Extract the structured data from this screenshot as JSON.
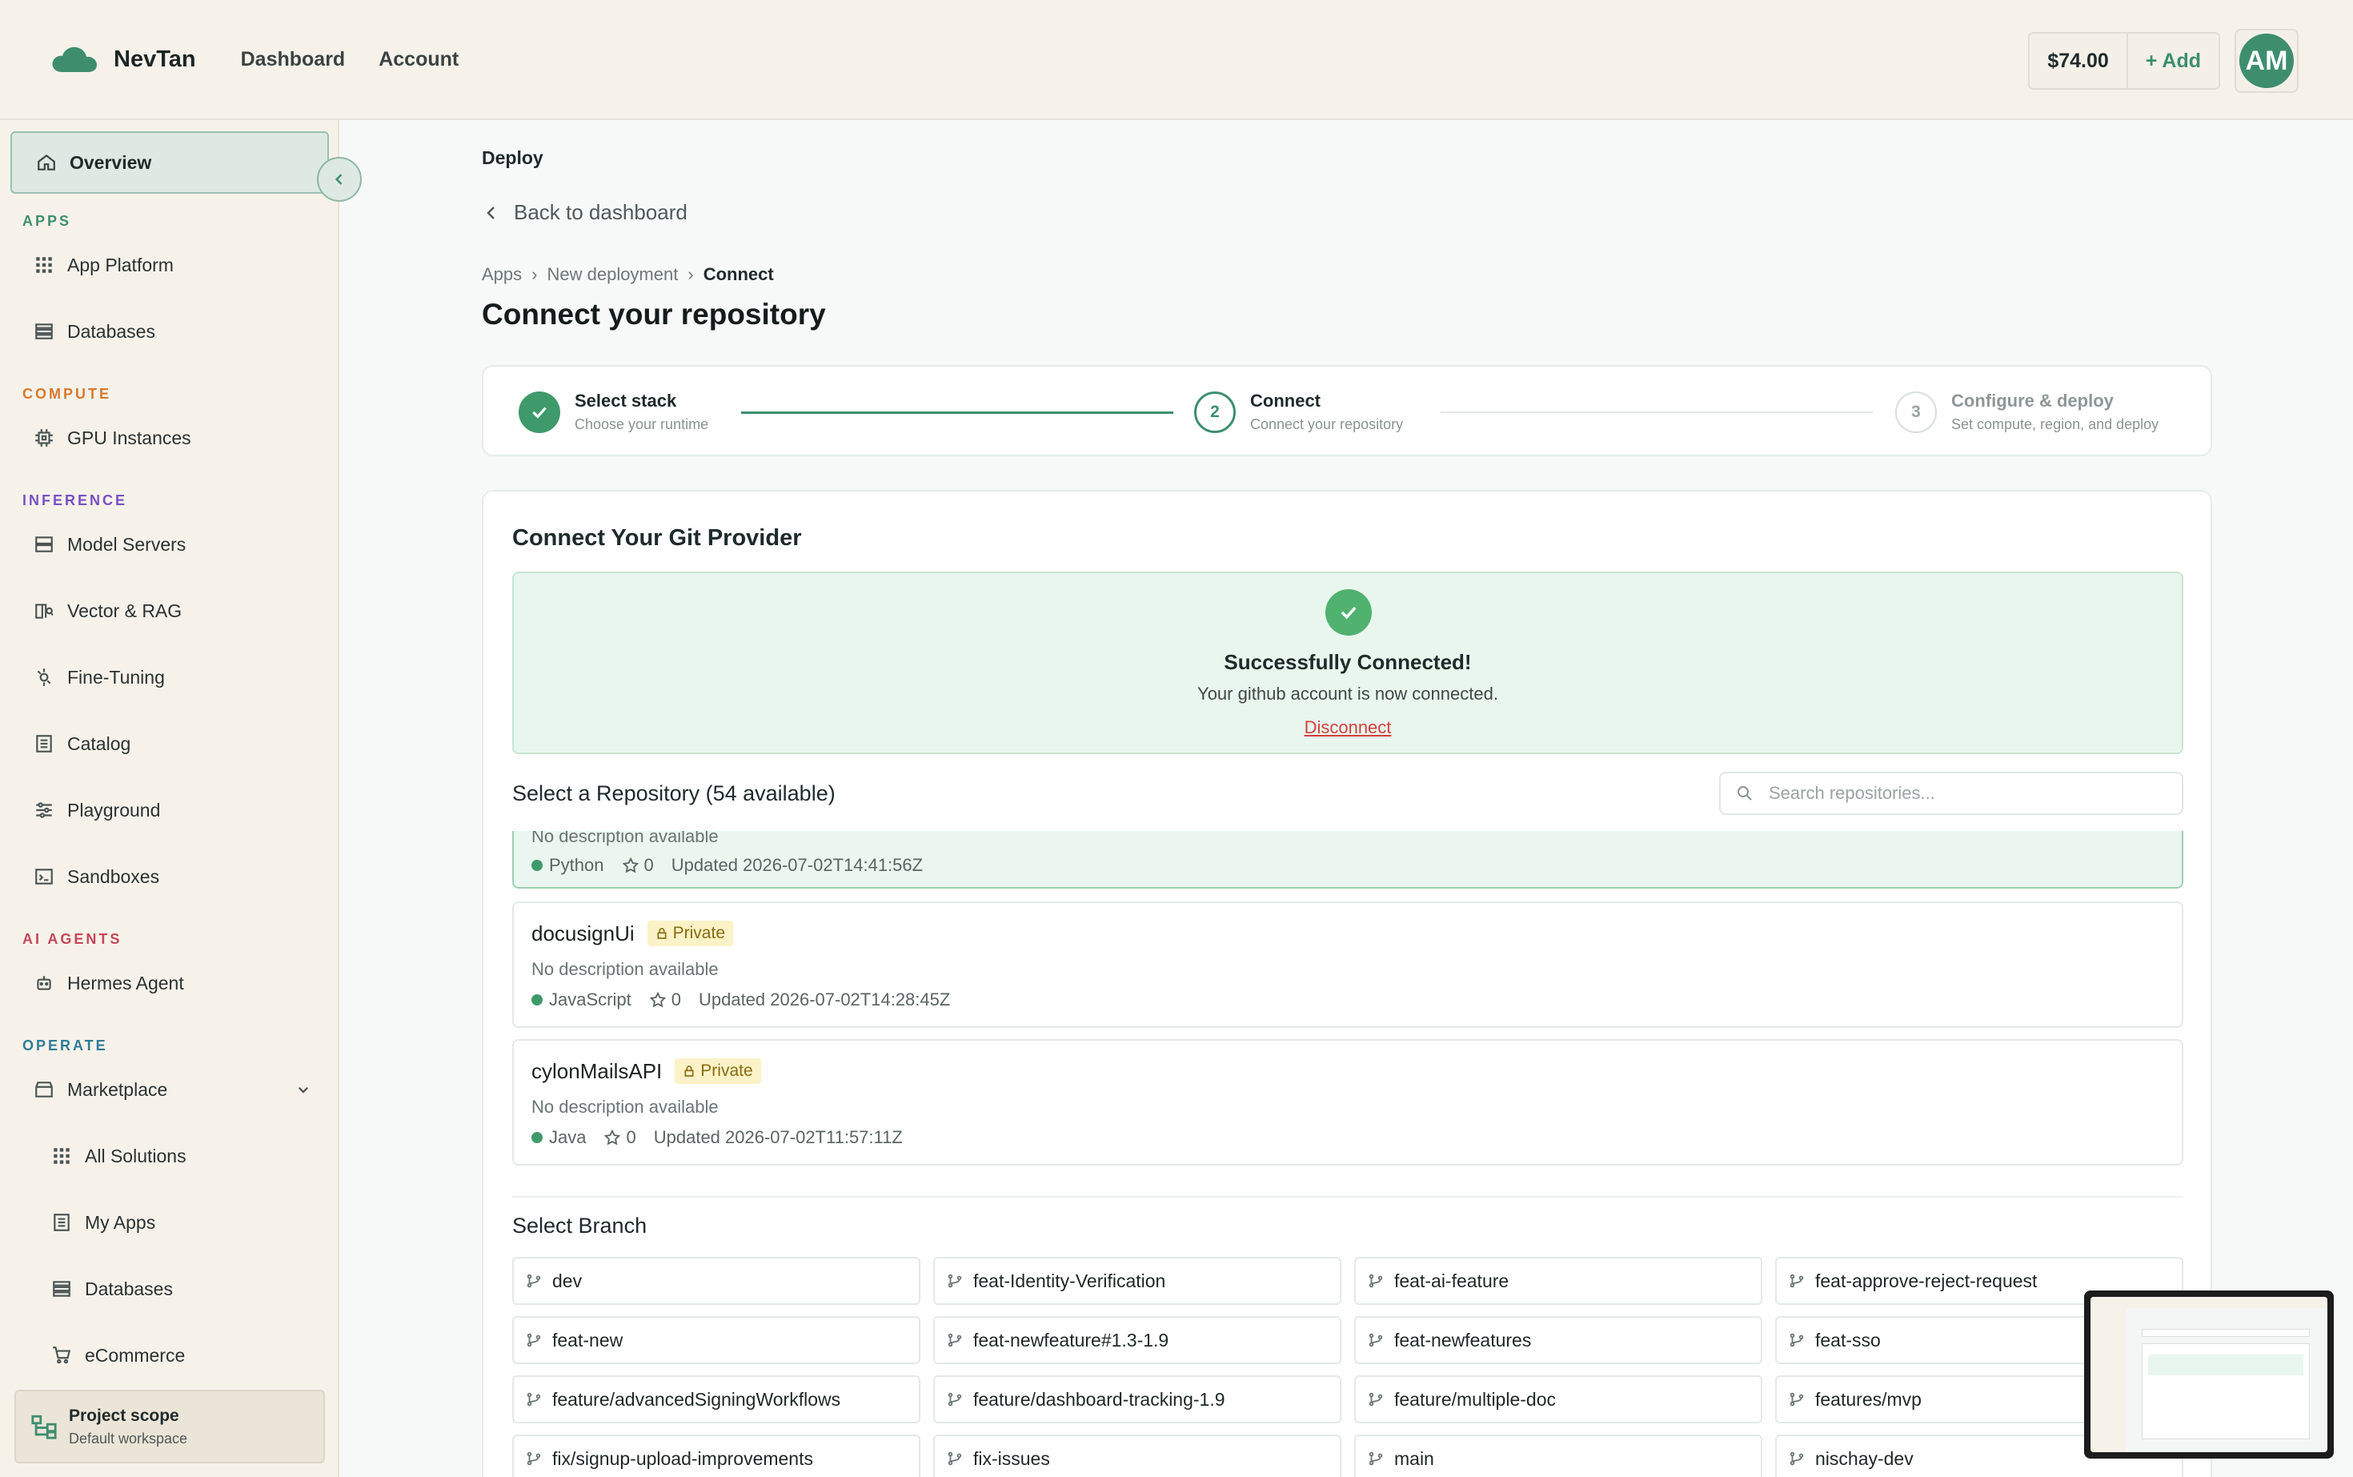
{
  "brand": {
    "name": "NevTan"
  },
  "topnav": [
    "Dashboard",
    "Account"
  ],
  "topbar": {
    "balance": "$74.00",
    "add_label": "+ Add",
    "avatar_initials": "AM"
  },
  "colors": {
    "accent": "#3e8e6e",
    "apps_label": "#3e8e6e",
    "compute_label": "#d77a2e",
    "inference_label": "#7a4fc4",
    "agents_label": "#c4475a",
    "operate_label": "#2f7c96"
  },
  "sidebar": {
    "overview": "Overview",
    "sections": {
      "apps": "APPS",
      "compute": "COMPUTE",
      "inference": "INFERENCE",
      "agents": "AI AGENTS",
      "operate": "OPERATE"
    },
    "items": {
      "app_platform": "App Platform",
      "databases": "Databases",
      "gpu": "GPU Instances",
      "model_servers": "Model Servers",
      "vector_rag": "Vector & RAG",
      "fine_tuning": "Fine-Tuning",
      "catalog": "Catalog",
      "playground": "Playground",
      "sandboxes": "Sandboxes",
      "hermes": "Hermes Agent",
      "marketplace": "Marketplace",
      "all_solutions": "All Solutions",
      "my_apps": "My Apps",
      "mp_databases": "Databases",
      "ecommerce": "eCommerce"
    },
    "project_scope": {
      "title": "Project scope",
      "subtitle": "Default workspace"
    }
  },
  "main": {
    "section": "Deploy",
    "back": "Back to dashboard",
    "breadcrumb": [
      "Apps",
      "New deployment",
      "Connect"
    ],
    "title": "Connect your repository",
    "steps": [
      {
        "num": "1",
        "title": "Select stack",
        "sub": "Choose your runtime",
        "state": "done"
      },
      {
        "num": "2",
        "title": "Connect",
        "sub": "Connect your repository",
        "state": "active"
      },
      {
        "num": "3",
        "title": "Configure & deploy",
        "sub": "Set compute, region, and deploy",
        "state": "pending"
      }
    ],
    "card_title": "Connect Your Git Provider",
    "success": {
      "title": "Successfully Connected!",
      "subtitle": "Your github account is now connected.",
      "disconnect": "Disconnect"
    },
    "repo_header": "Select a Repository (54 available)",
    "search_placeholder": "Search repositories...",
    "repos": [
      {
        "name": "",
        "private_label": "",
        "desc": "No description available",
        "lang": "Python",
        "stars": "0",
        "updated": "Updated 2026-07-02T14:41:56Z"
      },
      {
        "name": "docusignUi",
        "private_label": "Private",
        "desc": "No description available",
        "lang": "JavaScript",
        "stars": "0",
        "updated": "Updated 2026-07-02T14:28:45Z"
      },
      {
        "name": "cylonMailsAPI",
        "private_label": "Private",
        "desc": "No description available",
        "lang": "Java",
        "stars": "0",
        "updated": "Updated 2026-07-02T11:57:11Z"
      }
    ],
    "branch_header": "Select Branch",
    "branches": [
      "dev",
      "feat-Identity-Verification",
      "feat-ai-feature",
      "feat-approve-reject-request",
      "feat-new",
      "feat-newfeature#1.3-1.9",
      "feat-newfeatures",
      "feat-sso",
      "feature/advancedSigningWorkflows",
      "feature/dashboard-tracking-1.9",
      "feature/multiple-doc",
      "features/mvp",
      "fix/signup-upload-improvements",
      "fix-issues",
      "main",
      "nischay-dev"
    ]
  }
}
